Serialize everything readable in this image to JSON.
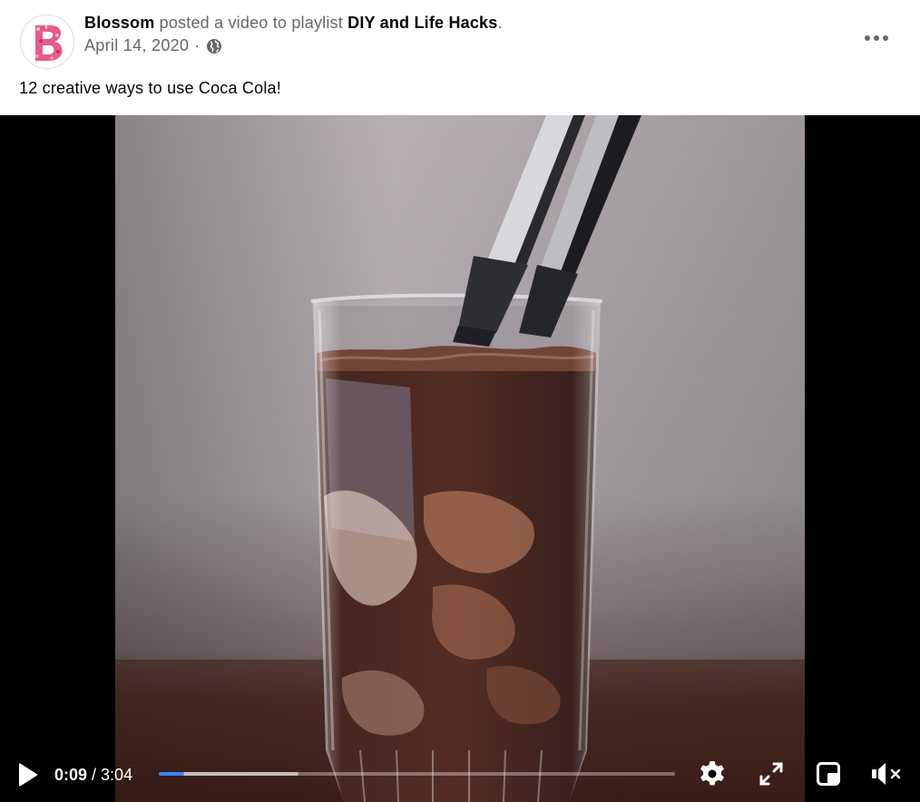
{
  "post": {
    "author": "Blossom",
    "action_text": " posted a video to playlist ",
    "playlist": "DIY and Life Hacks",
    "period": ".",
    "date": "April 14, 2020",
    "separator": "·",
    "privacy_icon": "globe-icon",
    "more_icon": "more-options-icon",
    "caption": "12 creative ways to use Coca Cola!"
  },
  "player": {
    "current_time": "0:09",
    "time_separator": " / ",
    "duration": "3:04",
    "progress_played": 0.049,
    "progress_buffered": 0.27,
    "icons": {
      "play": "play-icon",
      "settings": "settings-gear-icon",
      "fullscreen": "fullscreen-icon",
      "pip": "picture-in-picture-icon",
      "mute": "volume-muted-icon"
    },
    "accent_color": "#2d88ff"
  }
}
